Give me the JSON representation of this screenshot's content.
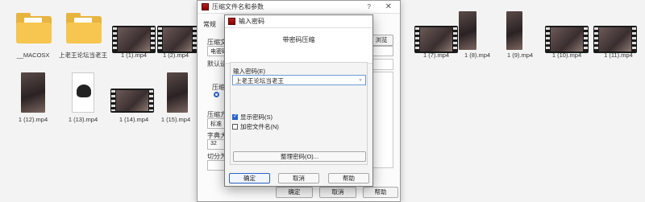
{
  "explorer": {
    "files": [
      {
        "label": "__MACOSX"
      },
      {
        "label": "上老王论坛当老王"
      },
      {
        "label": "1 (1).mp4"
      },
      {
        "label": "1 (2).mp4"
      },
      {
        "label": "1 (7).mp4"
      },
      {
        "label": "1 (8).mp4"
      },
      {
        "label": "1 (9).mp4"
      },
      {
        "label": "1 (10).mp4"
      },
      {
        "label": "1 (11).mp4"
      },
      {
        "label": "1 (12).mp4"
      },
      {
        "label": "1 (13).mp4"
      },
      {
        "label": "1 (14).mp4"
      },
      {
        "label": "1 (15).mp4"
      }
    ]
  },
  "bg_dialog": {
    "title": "压缩文件名和参数",
    "help": "?",
    "close": "✕",
    "tab": "常规",
    "label_archive": "压缩文",
    "archive_value": "电密码",
    "browse_label": "浏览(B)...",
    "label_default": "默认设",
    "label_format": "压缩",
    "label_method": "压缩方",
    "method_value": "标准",
    "label_dict": "字典大",
    "dict_value": "32",
    "label_split": "切分为",
    "ok": "确定",
    "cancel": "取消",
    "help_btn": "帮助"
  },
  "fg_dialog": {
    "title": "输入密码",
    "header": "带密码压缩",
    "input_label": "输入密码(E)",
    "password_value": "上老王论坛当老王",
    "show_password": "显示密码(S)",
    "show_password_checked": true,
    "encrypt_names": "加密文件名(N)",
    "encrypt_names_checked": false,
    "organize": "整理密码(O)...",
    "ok": "确定",
    "cancel": "取消",
    "help": "帮助"
  }
}
